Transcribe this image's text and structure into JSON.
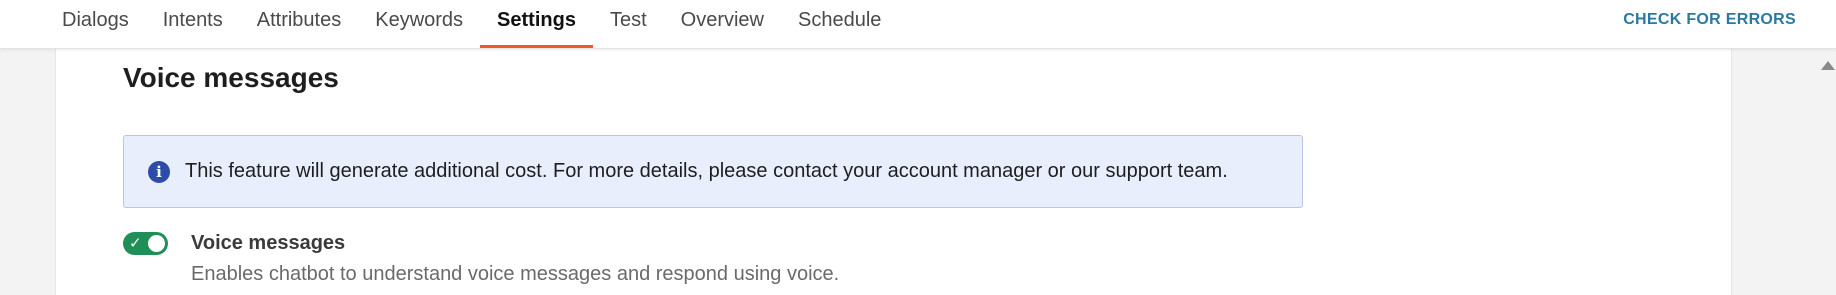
{
  "nav": {
    "tabs": [
      {
        "label": "Dialogs",
        "active": false
      },
      {
        "label": "Intents",
        "active": false
      },
      {
        "label": "Attributes",
        "active": false
      },
      {
        "label": "Keywords",
        "active": false
      },
      {
        "label": "Settings",
        "active": true
      },
      {
        "label": "Test",
        "active": false
      },
      {
        "label": "Overview",
        "active": false
      },
      {
        "label": "Schedule",
        "active": false
      }
    ],
    "check_errors_label": "CHECK FOR ERRORS"
  },
  "section": {
    "title": "Voice messages",
    "info": {
      "icon": "info-icon",
      "text": "This feature will generate additional cost. For more details, please contact your account manager or our support team."
    },
    "toggle": {
      "enabled": true,
      "title": "Voice messages",
      "description": "Enables chatbot to understand voice messages and respond using voice."
    }
  },
  "colors": {
    "accent_tab": "#f0592a",
    "link": "#2a7aa0",
    "toggle_on": "#1f8f57",
    "info_bg": "#e8eefc",
    "info_icon": "#2c4ca8"
  }
}
